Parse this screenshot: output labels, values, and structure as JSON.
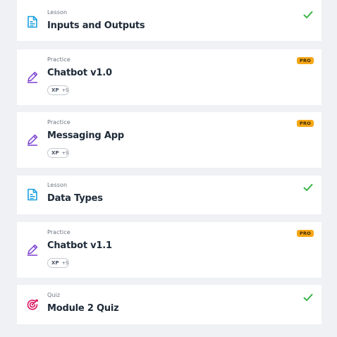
{
  "items": [
    {
      "kind": "Lesson",
      "title": "Inputs and Outputs",
      "icon": "lesson-icon",
      "status": "completed"
    },
    {
      "kind": "Practice",
      "title": "Chatbot v1.0",
      "icon": "practice-icon",
      "badge": "PRO",
      "xp_label": "XP",
      "xp_value": "+5"
    },
    {
      "kind": "Practice",
      "title": "Messaging App",
      "icon": "practice-icon",
      "badge": "PRO",
      "xp_label": "XP",
      "xp_value": "+5"
    },
    {
      "kind": "Lesson",
      "title": "Data Types",
      "icon": "lesson-icon",
      "status": "completed"
    },
    {
      "kind": "Practice",
      "title": "Chatbot v1.1",
      "icon": "practice-icon",
      "badge": "PRO",
      "xp_label": "XP",
      "xp_value": "+5"
    },
    {
      "kind": "Quiz",
      "title": "Module 2 Quiz",
      "icon": "quiz-icon",
      "status": "completed"
    }
  ],
  "colors": {
    "lesson_icon": "#1aa0e0",
    "practice_icon": "#7b3fd0",
    "quiz_icon": "#d8125d",
    "check": "#3bb54a",
    "pro_badge": "#f6a717",
    "background": "#eff1f4"
  }
}
